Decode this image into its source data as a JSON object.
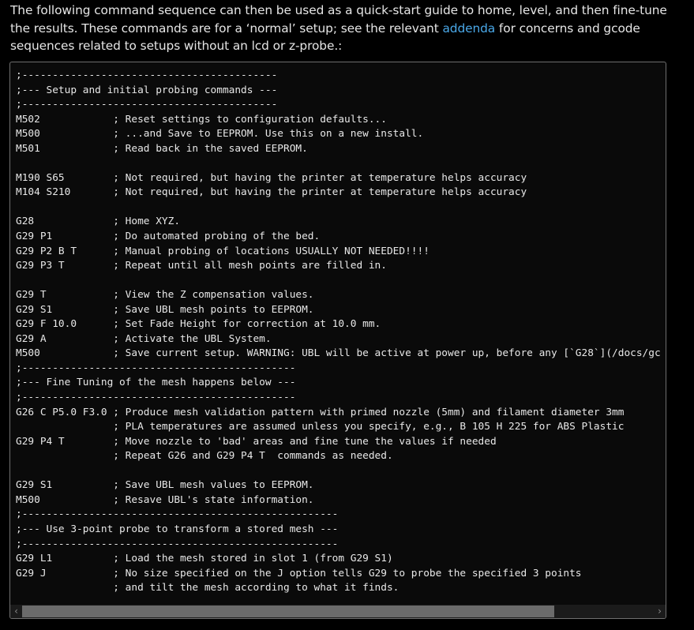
{
  "intro": {
    "before_link": "The following command sequence can then be used as a quick-start guide to home, level, and then fine-tune the results. These commands are for a ‘normal’ setup; see the relevant ",
    "link_text": "addenda",
    "after_link": " for concerns and gcode sequences related to setups without an lcd or z-probe.:"
  },
  "code_lines": [
    ";------------------------------------------",
    ";--- Setup and initial probing commands ---",
    ";------------------------------------------",
    "M502            ; Reset settings to configuration defaults...",
    "M500            ; ...and Save to EEPROM. Use this on a new install.",
    "M501            ; Read back in the saved EEPROM.",
    "",
    "M190 S65        ; Not required, but having the printer at temperature helps accuracy",
    "M104 S210       ; Not required, but having the printer at temperature helps accuracy",
    "",
    "G28             ; Home XYZ.",
    "G29 P1          ; Do automated probing of the bed.",
    "G29 P2 B T      ; Manual probing of locations USUALLY NOT NEEDED!!!!",
    "G29 P3 T        ; Repeat until all mesh points are filled in.",
    "",
    "G29 T           ; View the Z compensation values.",
    "G29 S1          ; Save UBL mesh points to EEPROM.",
    "G29 F 10.0      ; Set Fade Height for correction at 10.0 mm.",
    "G29 A           ; Activate the UBL System.",
    "M500            ; Save current setup. WARNING: UBL will be active at power up, before any [`G28`](/docs/gc",
    ";---------------------------------------------",
    ";--- Fine Tuning of the mesh happens below ---",
    ";---------------------------------------------",
    "G26 C P5.0 F3.0 ; Produce mesh validation pattern with primed nozzle (5mm) and filament diameter 3mm",
    "                ; PLA temperatures are assumed unless you specify, e.g., B 105 H 225 for ABS Plastic",
    "G29 P4 T        ; Move nozzle to 'bad' areas and fine tune the values if needed",
    "                ; Repeat G26 and G29 P4 T  commands as needed.",
    "",
    "G29 S1          ; Save UBL mesh values to EEPROM.",
    "M500            ; Resave UBL's state information.",
    ";----------------------------------------------------",
    ";--- Use 3-point probe to transform a stored mesh ---",
    ";----------------------------------------------------",
    "G29 L1          ; Load the mesh stored in slot 1 (from G29 S1)",
    "G29 J           ; No size specified on the J option tells G29 to probe the specified 3 points",
    "                ; and tilt the mesh according to what it finds."
  ],
  "scrollbar": {
    "left_arrow_icon": "chevron-left-icon",
    "right_arrow_icon": "chevron-right-icon",
    "left_arrow_glyph": "‹",
    "right_arrow_glyph": "›",
    "thumb_fraction": 0.843,
    "thumb_offset_fraction": 0.0
  },
  "colors": {
    "background": "#000000",
    "text": "#e6e6e6",
    "link": "#4aa8e8",
    "code_background": "#0a0a0a",
    "code_border": "#6f6f6f",
    "scroll_thumb": "#6b6b6b"
  }
}
